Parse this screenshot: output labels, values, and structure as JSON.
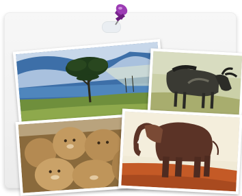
{
  "board": {
    "pin_color": "#8e2fa6",
    "clip_color": "#e9eef2",
    "photos": [
      {
        "subject": "acacia-tree-savanna",
        "icon": "tree-photo"
      },
      {
        "subject": "wildebeest",
        "icon": "wildebeest-photo"
      },
      {
        "subject": "lion-cubs",
        "icon": "lions-photo"
      },
      {
        "subject": "elephant",
        "icon": "elephant-photo"
      }
    ]
  }
}
